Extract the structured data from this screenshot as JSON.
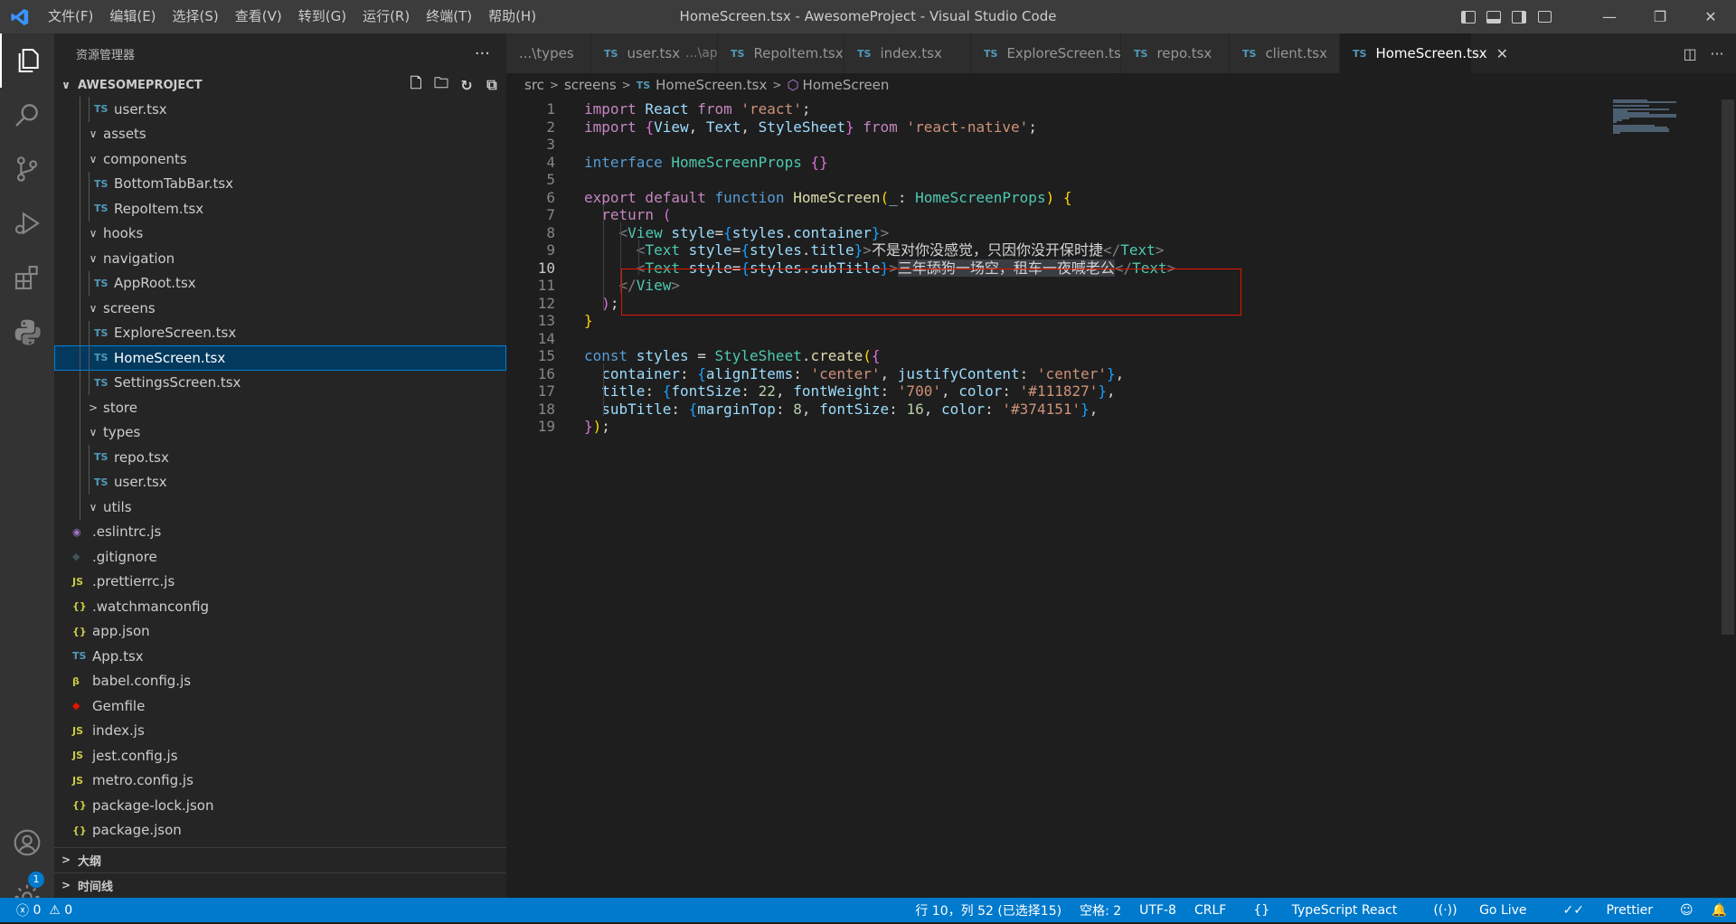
{
  "window": {
    "title": "HomeScreen.tsx - AwesomeProject - Visual Studio Code",
    "menu": [
      "文件(F)",
      "编辑(E)",
      "选择(S)",
      "查看(V)",
      "转到(G)",
      "运行(R)",
      "终端(T)",
      "帮助(H)"
    ]
  },
  "sidebar": {
    "title": "资源管理器",
    "more": "···",
    "project": "AWESOMEPROJECT",
    "tree": [
      {
        "label": "user.tsx",
        "icon": "TS",
        "kind": "ts",
        "depth": 2,
        "type": "file"
      },
      {
        "label": "assets",
        "depth": 1,
        "type": "folder",
        "open": true
      },
      {
        "label": "components",
        "depth": 1,
        "type": "folder",
        "open": true
      },
      {
        "label": "BottomTabBar.tsx",
        "icon": "TS",
        "kind": "ts",
        "depth": 2,
        "type": "file"
      },
      {
        "label": "RepoItem.tsx",
        "icon": "TS",
        "kind": "ts",
        "depth": 2,
        "type": "file"
      },
      {
        "label": "hooks",
        "depth": 1,
        "type": "folder",
        "open": true
      },
      {
        "label": "navigation",
        "depth": 1,
        "type": "folder",
        "open": true
      },
      {
        "label": "AppRoot.tsx",
        "icon": "TS",
        "kind": "ts",
        "depth": 2,
        "type": "file"
      },
      {
        "label": "screens",
        "depth": 1,
        "type": "folder",
        "open": true
      },
      {
        "label": "ExploreScreen.tsx",
        "icon": "TS",
        "kind": "ts",
        "depth": 2,
        "type": "file"
      },
      {
        "label": "HomeScreen.tsx",
        "icon": "TS",
        "kind": "ts",
        "depth": 2,
        "type": "file",
        "selected": true
      },
      {
        "label": "SettingsScreen.tsx",
        "icon": "TS",
        "kind": "ts",
        "depth": 2,
        "type": "file"
      },
      {
        "label": "store",
        "depth": 1,
        "type": "folder",
        "open": false
      },
      {
        "label": "types",
        "depth": 1,
        "type": "folder",
        "open": true
      },
      {
        "label": "repo.tsx",
        "icon": "TS",
        "kind": "ts",
        "depth": 2,
        "type": "file"
      },
      {
        "label": "user.tsx",
        "icon": "TS",
        "kind": "ts",
        "depth": 2,
        "type": "file"
      },
      {
        "label": "utils",
        "depth": 1,
        "type": "folder",
        "open": true
      },
      {
        "label": ".eslintrc.js",
        "icon": "◉",
        "kind": "eslint",
        "depth": 0,
        "type": "file"
      },
      {
        "label": ".gitignore",
        "icon": "◆",
        "kind": "git",
        "depth": 0,
        "type": "file"
      },
      {
        "label": ".prettierrc.js",
        "icon": "JS",
        "kind": "js",
        "depth": 0,
        "type": "file"
      },
      {
        "label": ".watchmanconfig",
        "icon": "{}",
        "kind": "json",
        "depth": 0,
        "type": "file"
      },
      {
        "label": "app.json",
        "icon": "{}",
        "kind": "json",
        "depth": 0,
        "type": "file"
      },
      {
        "label": "App.tsx",
        "icon": "TS",
        "kind": "ts",
        "depth": 0,
        "type": "file"
      },
      {
        "label": "babel.config.js",
        "icon": "β",
        "kind": "babel",
        "depth": 0,
        "type": "file"
      },
      {
        "label": "Gemfile",
        "icon": "◆",
        "kind": "gem",
        "depth": 0,
        "type": "file"
      },
      {
        "label": "index.js",
        "icon": "JS",
        "kind": "js",
        "depth": 0,
        "type": "file"
      },
      {
        "label": "jest.config.js",
        "icon": "JS",
        "kind": "js",
        "depth": 0,
        "type": "file"
      },
      {
        "label": "metro.config.js",
        "icon": "JS",
        "kind": "js",
        "depth": 0,
        "type": "file"
      },
      {
        "label": "package-lock.json",
        "icon": "{}",
        "kind": "json",
        "depth": 0,
        "type": "file"
      },
      {
        "label": "package.json",
        "icon": "{}",
        "kind": "json",
        "depth": 0,
        "type": "file"
      }
    ],
    "outline": "大纲",
    "timeline": "时间线",
    "accounts_badge": "1"
  },
  "tabs": [
    {
      "label": "...\\types",
      "icon": ""
    },
    {
      "label": "user.tsx",
      "desc": "...\\api",
      "icon": "TS"
    },
    {
      "label": "RepoItem.tsx",
      "icon": "TS"
    },
    {
      "label": "index.tsx",
      "icon": "TS"
    },
    {
      "label": "ExploreScreen.tsx",
      "icon": "TS"
    },
    {
      "label": "repo.tsx",
      "icon": "TS"
    },
    {
      "label": "client.tsx",
      "icon": "TS"
    },
    {
      "label": "HomeScreen.tsx",
      "icon": "TS",
      "active": true
    }
  ],
  "breadcrumb": {
    "parts": [
      "src",
      "screens",
      "HomeScreen.tsx",
      "HomeScreen"
    ],
    "file_icon": "TS"
  },
  "editor": {
    "current_line": 10,
    "lines": [
      [
        [
          "import",
          "c"
        ],
        [
          " React ",
          "v"
        ],
        [
          "from",
          "c"
        ],
        [
          " 'react'",
          "s"
        ],
        [
          ";",
          "p"
        ]
      ],
      [
        [
          "import",
          "c"
        ],
        [
          " ",
          "p"
        ],
        [
          "{",
          "pk"
        ],
        [
          "View",
          "v"
        ],
        [
          ", ",
          "p"
        ],
        [
          "Text",
          "v"
        ],
        [
          ", ",
          "p"
        ],
        [
          "StyleSheet",
          "v"
        ],
        [
          "}",
          "pk"
        ],
        [
          " from",
          "c"
        ],
        [
          " 'react-native'",
          "s"
        ],
        [
          ";",
          "p"
        ]
      ],
      [],
      [
        [
          "interface",
          "k"
        ],
        [
          " HomeScreenProps ",
          "t"
        ],
        [
          "{}",
          "pk"
        ]
      ],
      [],
      [
        [
          "export",
          "c"
        ],
        [
          " default",
          "c"
        ],
        [
          " function",
          "k"
        ],
        [
          " HomeScreen",
          "f"
        ],
        [
          "(",
          "y"
        ],
        [
          "_",
          "v"
        ],
        [
          ": ",
          "p"
        ],
        [
          "HomeScreenProps",
          "t"
        ],
        [
          ")",
          "y"
        ],
        [
          " {",
          "y"
        ]
      ],
      [
        [
          "  return",
          "c"
        ],
        [
          " (",
          "pk"
        ]
      ],
      [
        [
          "    <",
          "tg"
        ],
        [
          "View",
          "tg2"
        ],
        [
          " style",
          "v"
        ],
        [
          "=",
          "p"
        ],
        [
          "{",
          "bl"
        ],
        [
          "styles",
          "v"
        ],
        [
          ".",
          "p"
        ],
        [
          "container",
          "v"
        ],
        [
          "}",
          "bl"
        ],
        [
          ">",
          "tg"
        ]
      ],
      [
        [
          "      <",
          "tg"
        ],
        [
          "Text",
          "tg2"
        ],
        [
          " style",
          "v"
        ],
        [
          "=",
          "p"
        ],
        [
          "{",
          "bl"
        ],
        [
          "styles",
          "v"
        ],
        [
          ".",
          "p"
        ],
        [
          "title",
          "v"
        ],
        [
          "}",
          "bl"
        ],
        [
          ">",
          "tg"
        ],
        [
          "不是对你没感觉，只因你没开保时捷",
          "p"
        ],
        [
          "</",
          "tg"
        ],
        [
          "Text",
          "tg2"
        ],
        [
          ">",
          "tg"
        ]
      ],
      [
        [
          "      <",
          "tg"
        ],
        [
          "Text",
          "tg2"
        ],
        [
          " style",
          "v"
        ],
        [
          "=",
          "p"
        ],
        [
          "{",
          "bl"
        ],
        [
          "styles",
          "v"
        ],
        [
          ".",
          "p"
        ],
        [
          "subTitle",
          "v"
        ],
        [
          "}",
          "bl"
        ],
        [
          ">",
          "tg"
        ],
        [
          "三年舔狗一场空，租车一夜喊老公",
          "p hl"
        ],
        [
          "</",
          "tg"
        ],
        [
          "Text",
          "tg2"
        ],
        [
          ">",
          "tg"
        ]
      ],
      [
        [
          "    </",
          "tg"
        ],
        [
          "View",
          "tg2"
        ],
        [
          ">",
          "tg"
        ]
      ],
      [
        [
          "  )",
          "pk"
        ],
        [
          ";",
          "p"
        ]
      ],
      [
        [
          "}",
          "y"
        ]
      ],
      [],
      [
        [
          "const",
          "k"
        ],
        [
          " styles ",
          "v"
        ],
        [
          "= ",
          "p"
        ],
        [
          "StyleSheet",
          "t"
        ],
        [
          ".",
          "p"
        ],
        [
          "create",
          "f"
        ],
        [
          "(",
          "y"
        ],
        [
          "{",
          "pk"
        ]
      ],
      [
        [
          "  container",
          "v"
        ],
        [
          ": ",
          "p"
        ],
        [
          "{",
          "bl"
        ],
        [
          "alignItems",
          "v"
        ],
        [
          ": ",
          "p"
        ],
        [
          "'center'",
          "s"
        ],
        [
          ", ",
          "p"
        ],
        [
          "justifyContent",
          "v"
        ],
        [
          ": ",
          "p"
        ],
        [
          "'center'",
          "s"
        ],
        [
          "}",
          "bl"
        ],
        [
          ",",
          "p"
        ]
      ],
      [
        [
          "  title",
          "v"
        ],
        [
          ": ",
          "p"
        ],
        [
          "{",
          "bl"
        ],
        [
          "fontSize",
          "v"
        ],
        [
          ": ",
          "p"
        ],
        [
          "22",
          "n"
        ],
        [
          ", ",
          "p"
        ],
        [
          "fontWeight",
          "v"
        ],
        [
          ": ",
          "p"
        ],
        [
          "'700'",
          "s"
        ],
        [
          ", ",
          "p"
        ],
        [
          "color",
          "v"
        ],
        [
          ": ",
          "p"
        ],
        [
          "'#111827'",
          "s"
        ],
        [
          "}",
          "bl"
        ],
        [
          ",",
          "p"
        ]
      ],
      [
        [
          "  subTitle",
          "v"
        ],
        [
          ": ",
          "p"
        ],
        [
          "{",
          "bl"
        ],
        [
          "marginTop",
          "v"
        ],
        [
          ": ",
          "p"
        ],
        [
          "8",
          "n"
        ],
        [
          ", ",
          "p"
        ],
        [
          "fontSize",
          "v"
        ],
        [
          ": ",
          "p"
        ],
        [
          "16",
          "n"
        ],
        [
          ", ",
          "p"
        ],
        [
          "color",
          "v"
        ],
        [
          ": ",
          "p"
        ],
        [
          "'#374151'",
          "s"
        ],
        [
          "}",
          "bl"
        ],
        [
          ",",
          "p"
        ]
      ],
      [
        [
          "}",
          "pk"
        ],
        [
          ")",
          "y"
        ],
        [
          ";",
          "p"
        ]
      ]
    ]
  },
  "status": {
    "errors": "0",
    "warnings": "0",
    "position": "行 10，列 52 (已选择15)",
    "spaces": "空格: 2",
    "encoding": "UTF-8",
    "eol": "CRLF",
    "language": "TypeScript React",
    "golive": "Go Live",
    "prettier": "Prettier"
  },
  "colors": {
    "accent": "#007acc",
    "selection": "#04395e",
    "highlight_box": "#e51400"
  }
}
